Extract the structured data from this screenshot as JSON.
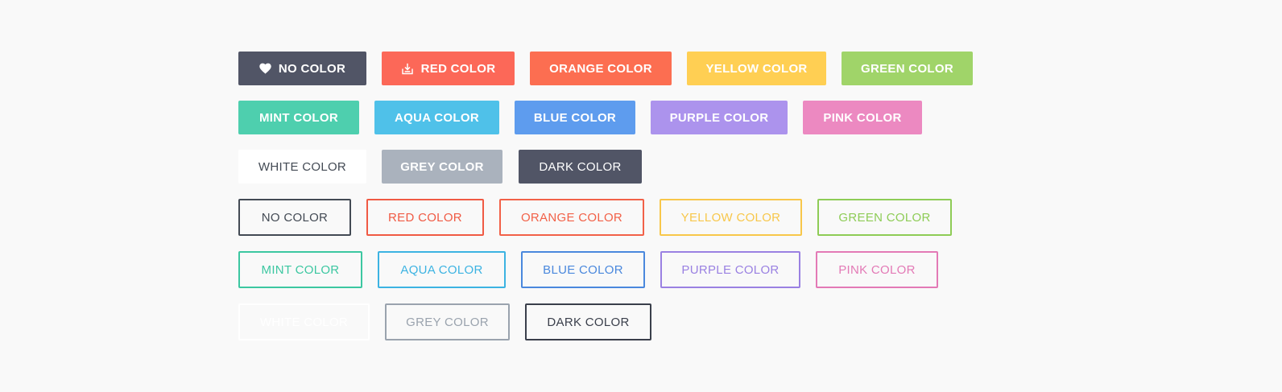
{
  "buttons": {
    "solid_row1": [
      {
        "label": "NO COLOR",
        "icon": "heart-icon",
        "bg": "#515566",
        "fg": "#ffffff"
      },
      {
        "label": "RED COLOR",
        "icon": "download-tray-icon",
        "bg": "#fc6858",
        "fg": "#ffffff"
      },
      {
        "label": "ORANGE COLOR",
        "bg": "#fc6e51",
        "fg": "#ffffff"
      },
      {
        "label": "YELLOW COLOR",
        "bg": "#ffcf53",
        "fg": "#ffffff"
      },
      {
        "label": "GREEN COLOR",
        "bg": "#a0d469",
        "fg": "#ffffff"
      }
    ],
    "solid_row2": [
      {
        "label": "MINT COLOR",
        "bg": "#4ecfae",
        "fg": "#ffffff"
      },
      {
        "label": "AQUA COLOR",
        "bg": "#4fc1e9",
        "fg": "#ffffff"
      },
      {
        "label": "BLUE COLOR",
        "bg": "#5e9cee",
        "fg": "#ffffff"
      },
      {
        "label": "PURPLE COLOR",
        "bg": "#ac93ed",
        "fg": "#ffffff"
      },
      {
        "label": "PINK COLOR",
        "bg": "#ec89c1",
        "fg": "#ffffff"
      }
    ],
    "solid_row3": [
      {
        "label": "WHITE COLOR",
        "bg": "#ffffff",
        "fg": "#434a54"
      },
      {
        "label": "GREY COLOR",
        "bg": "#aab2bd",
        "fg": "#ffffff"
      },
      {
        "label": "DARK COLOR",
        "bg": "#515566",
        "fg": "#ffffff"
      }
    ],
    "outline_row1": [
      {
        "label": "NO COLOR",
        "color": "#434a54"
      },
      {
        "label": "RED COLOR",
        "color": "#f05a44"
      },
      {
        "label": "ORANGE COLOR",
        "color": "#f26148"
      },
      {
        "label": "YELLOW COLOR",
        "color": "#f8c74a"
      },
      {
        "label": "GREEN COLOR",
        "color": "#8ecc56"
      }
    ],
    "outline_row2": [
      {
        "label": "MINT COLOR",
        "color": "#3cc7a1"
      },
      {
        "label": "AQUA COLOR",
        "color": "#3cb3e2"
      },
      {
        "label": "BLUE COLOR",
        "color": "#4a88dd"
      },
      {
        "label": "PURPLE COLOR",
        "color": "#9a81e2"
      },
      {
        "label": "PINK COLOR",
        "color": "#e37ab6"
      }
    ],
    "outline_row3": [
      {
        "label": "WHITE COLOR",
        "color": "#ffffff"
      },
      {
        "label": "GREY COLOR",
        "color": "#9aa3ae"
      },
      {
        "label": "DARK COLOR",
        "color": "#3a3f4b"
      }
    ]
  }
}
